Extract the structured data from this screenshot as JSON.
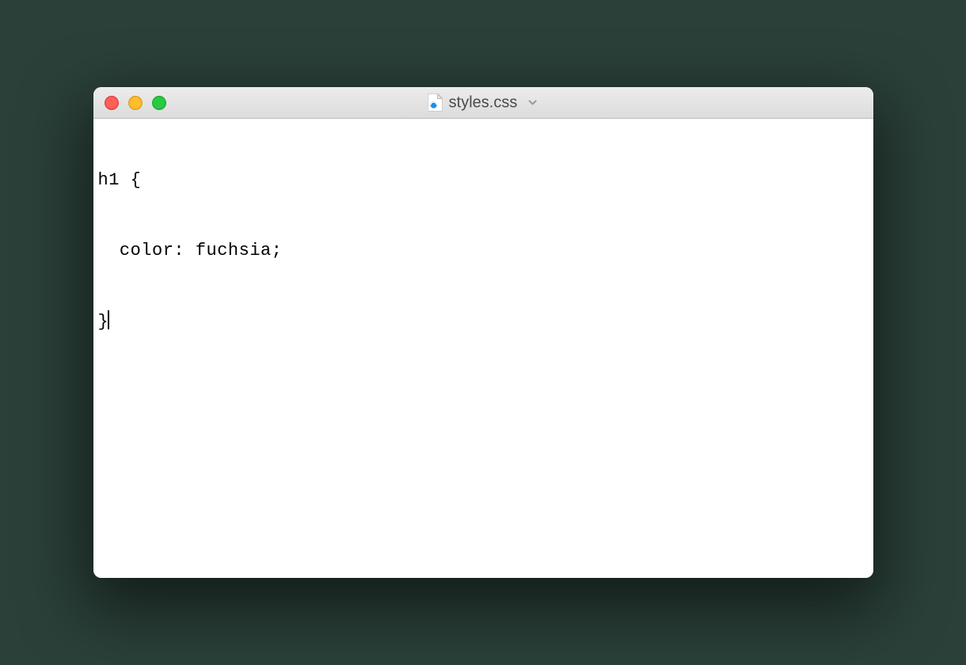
{
  "window": {
    "filename": "styles.css",
    "file_icon": "css-file-icon"
  },
  "editor": {
    "lines": [
      "h1 {",
      "  color: fuchsia;",
      "}"
    ],
    "cursor_after_last_line": true
  }
}
